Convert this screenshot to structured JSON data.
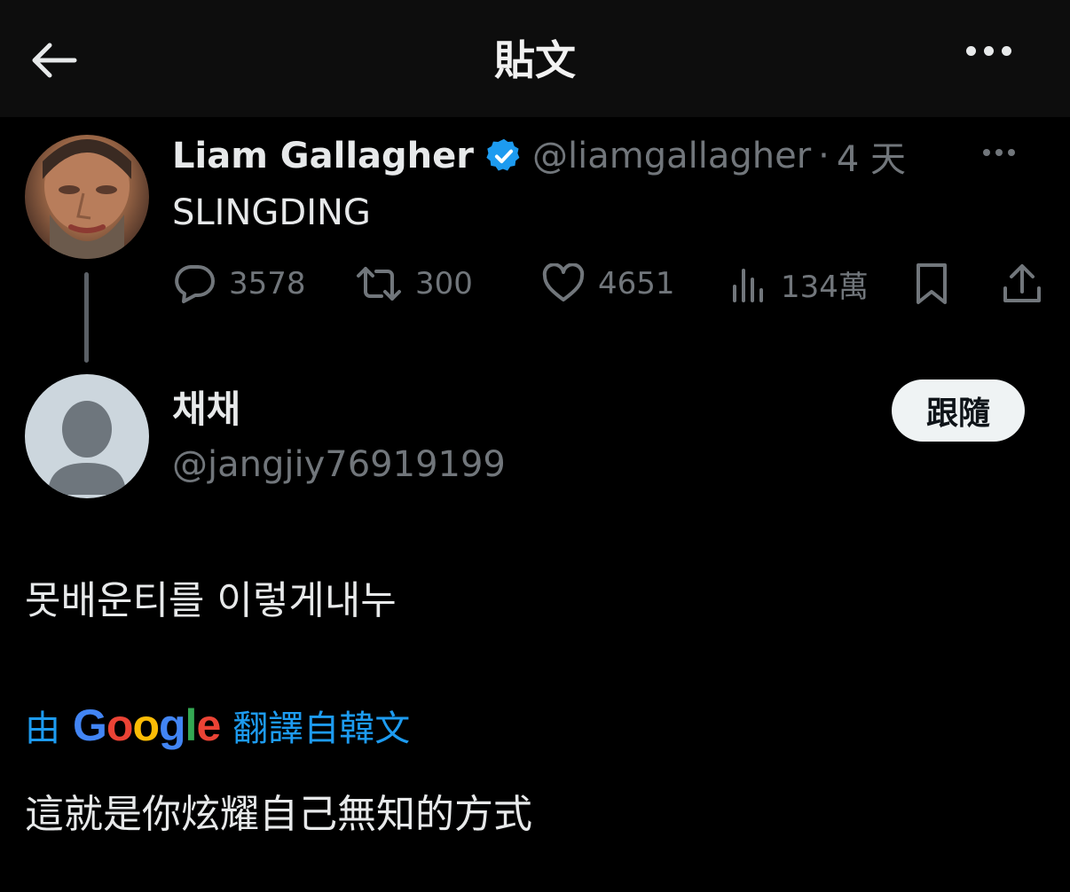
{
  "header": {
    "title": "貼文"
  },
  "original_post": {
    "display_name": "Liam Gallagher",
    "handle": "@liamgallagher",
    "separator": "·",
    "time": "4 天",
    "text": "SLINGDING",
    "stats": {
      "replies": "3578",
      "reposts": "300",
      "likes": "4651",
      "views": "134萬"
    }
  },
  "reply": {
    "display_name": "채채",
    "handle": "@jangjiy76919199",
    "follow_label": "跟隨",
    "text": "못배운티를 이렇게내누",
    "translation": {
      "prefix": "由",
      "provider": "Google",
      "suffix": "翻譯自韓文",
      "text": "這就是你炫耀自己無知的方式"
    }
  },
  "colors": {
    "background": "#000000",
    "header_bg": "#0d0d0d",
    "primary_text": "#e7e9ea",
    "secondary_text": "#71767b",
    "accent_blue": "#1d9bf0"
  }
}
